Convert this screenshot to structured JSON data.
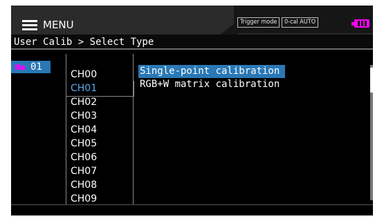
{
  "header": {
    "menu_label": "MENU",
    "trigger_mode": "Trigger mode",
    "zero_cal": "0-cal AUTO"
  },
  "breadcrumb": "User Calib > Select Type",
  "probe": {
    "label": "01"
  },
  "channels": [
    "CH00",
    "CH01",
    "CH02",
    "CH03",
    "CH04",
    "CH05",
    "CH06",
    "CH07",
    "CH08",
    "CH09"
  ],
  "selected_channel": "CH01",
  "calibration_types": [
    "Single-point calibration",
    "RGB+W matrix calibration"
  ],
  "selected_type": "Single-point calibration",
  "colors": {
    "accent_blue": "#2a78b5",
    "channel_blue": "#5aaaf0",
    "magenta": "#ff00ff"
  },
  "icons": {
    "menu": "hamburger-icon",
    "battery": "battery-icon",
    "probe": "probe-connector-icon"
  }
}
